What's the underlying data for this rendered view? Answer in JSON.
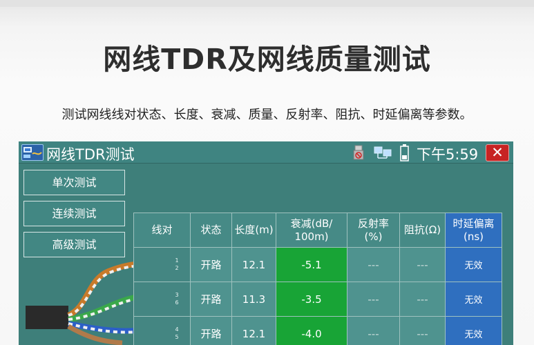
{
  "page": {
    "headline": "网线TDR及网线质量测试",
    "subline": "测试网线线对状态、长度、衰减、质量、反射率、阻抗、时延偏离等参数。"
  },
  "app": {
    "title": "网线TDR测试",
    "clock": "下午5:59",
    "close_label": "✕",
    "icons": [
      "app-icon",
      "usb-icon",
      "network-icon",
      "battery-icon",
      "close-icon"
    ]
  },
  "sidebar": {
    "buttons": [
      {
        "label": "单次测试"
      },
      {
        "label": "连续测试"
      },
      {
        "label": "高级测试"
      }
    ]
  },
  "table": {
    "headers": [
      "线对",
      "状态",
      "长度(m)",
      "衰减(dB/\n100m)",
      "反射率\n(%)",
      "阻抗(Ω)",
      "时延偏离\n(ns)"
    ],
    "rows": [
      {
        "pins": [
          "1",
          "2"
        ],
        "status": "开路",
        "length": "12.1",
        "attenuation": "-5.1",
        "reflectance": "---",
        "impedance": "---",
        "skew": "无效"
      },
      {
        "pins": [
          "3",
          "6"
        ],
        "status": "开路",
        "length": "11.3",
        "attenuation": "-3.5",
        "reflectance": "---",
        "impedance": "---",
        "skew": "无效"
      },
      {
        "pins": [
          "4",
          "5"
        ],
        "status": "开路",
        "length": "12.1",
        "attenuation": "-4.0",
        "reflectance": "---",
        "impedance": "---",
        "skew": "无效"
      }
    ]
  },
  "colors": {
    "screen_bg": "#3e7f7a",
    "attenuation_cell": "#18a436",
    "skew_column": "#2f6fbf",
    "close_button": "#c72323"
  }
}
